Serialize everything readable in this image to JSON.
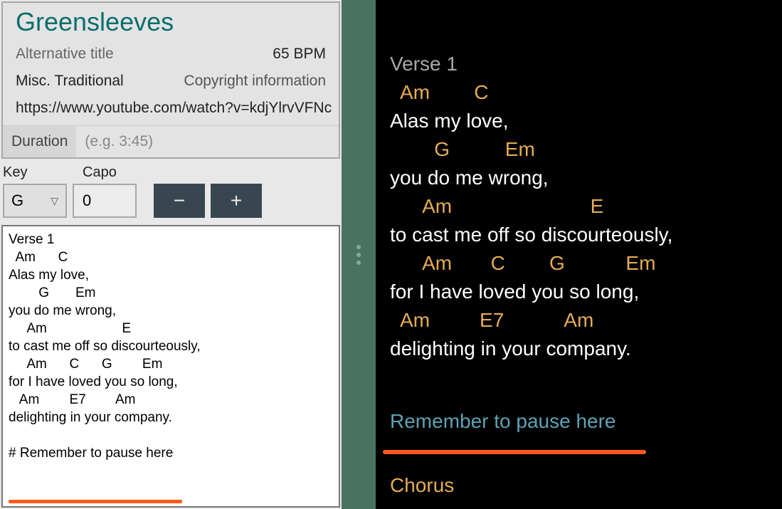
{
  "meta": {
    "title": "Greensleeves",
    "alt_title_placeholder": "Alternative title",
    "bpm": "65 BPM",
    "artist": "Misc. Traditional",
    "copyright_placeholder": "Copyright information",
    "url": "https://www.youtube.com/watch?v=kdjYlrvVFNc",
    "duration_label": "Duration",
    "duration_placeholder": "(e.g. 3:45)"
  },
  "controls": {
    "key_label": "Key",
    "capo_label": "Capo",
    "key_value": "G",
    "capo_value": "0",
    "minus": "−",
    "plus": "+"
  },
  "editor_text": "Verse 1\n  Am      C\nAlas my love,\n        G       Em\nyou do me wrong,\n     Am                    E\nto cast me off so discourteously,\n     Am      C      G        Em\nfor I have loved you so long,\n   Am        E7        Am\ndelighting in your company.\n\n# Remember to pause here",
  "preview": {
    "section1": "Verse 1",
    "lines": [
      {
        "chord": "  Am        C",
        "lyric": "Alas my love,"
      },
      {
        "chord": "        G          Em",
        "lyric": "you do me wrong,"
      },
      {
        "chord": "      Am                         E",
        "lyric": "to cast me off so discourteously,"
      },
      {
        "chord": "      Am       C        G           Em",
        "lyric": "for I have loved you so long,"
      },
      {
        "chord": "  Am         E7           Am",
        "lyric": "delighting in your company."
      }
    ],
    "comment": "Remember to pause here",
    "chorus_peek": "Chorus"
  }
}
